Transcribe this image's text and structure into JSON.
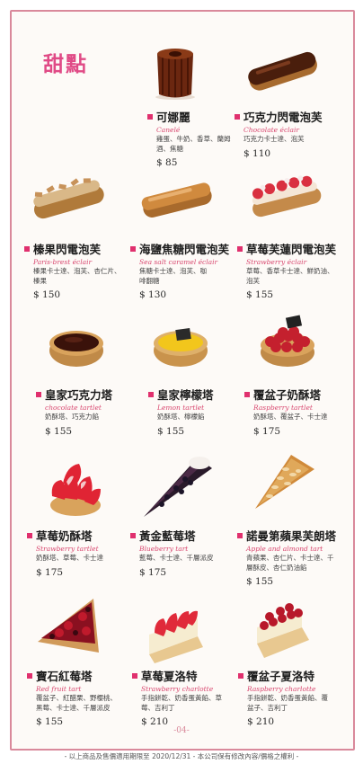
{
  "section_title": "甜點",
  "items": [
    {
      "name": "可娜麗",
      "en": "Canelé",
      "ing": "雞蛋、牛奶、香草、蘭姆酒、焦糖",
      "price": "$ 85"
    },
    {
      "name": "巧克力閃電泡芙",
      "en": "Chocolate éclair",
      "ing": "巧克力卡士達、泡芙",
      "price": "$ 110"
    },
    {
      "name": "榛果閃電泡芙",
      "en": "Paris-brest éclair",
      "ing": "榛果卡士達、泡芙、杏仁片、榛果",
      "price": "$ 150"
    },
    {
      "name": "海鹽焦糖閃電泡芙",
      "en": "Sea salt caramel éclair",
      "ing": "焦糖卡士達、泡芙、咖啡翻糖",
      "price": "$ 130"
    },
    {
      "name": "草莓芙蓮閃電泡芙",
      "en": "Strawberry éclair",
      "ing": "草莓、香草卡士達、鮮奶油、泡芙",
      "price": "$ 155"
    },
    {
      "name": "皇家巧克力塔",
      "en": "chocolate tartlet",
      "ing": "奶酥塔、巧克力餡",
      "price": "$ 155"
    },
    {
      "name": "皇家檸檬塔",
      "en": "Lemon tartlet",
      "ing": "奶酥塔、檸檬餡",
      "price": "$ 155"
    },
    {
      "name": "覆盆子奶酥塔",
      "en": "Raspberry tartlet",
      "ing": "奶酥塔、覆盆子、卡士達",
      "price": "$ 175"
    },
    {
      "name": "草莓奶酥塔",
      "en": "Strawberry tartlet",
      "ing": "奶酥塔、草莓、卡士達",
      "price": "$ 175"
    },
    {
      "name": "黃金藍莓塔",
      "en": "Blueberry tart",
      "ing": "藍莓、卡士達、千層派皮",
      "price": "$ 175"
    },
    {
      "name": "諾曼第蘋果芙朗塔",
      "en": "Apple and almond tart",
      "ing": "青蘋果、杏仁片、卡士達、千層酥皮、杏仁奶油餡",
      "price": "$ 155"
    },
    {
      "name": "寶石紅莓塔",
      "en": "Red fruit tart",
      "ing": "覆盆子、紅醋栗、野櫻桃、黑莓、卡士達、千層派皮",
      "price": "$ 155"
    },
    {
      "name": "草莓夏洛特",
      "en": "Strawberry charlotte",
      "ing": "手指餅乾、奶香蛋黃餡、草莓、吉利丁",
      "price": "$ 210"
    },
    {
      "name": "覆盆子夏洛特",
      "en": "Raspberry charlotte",
      "ing": "手指餅乾、奶香蛋黃餡、覆盆子、吉利丁",
      "price": "$ 210"
    }
  ],
  "page_number": "-04-",
  "footer": "- 以上商品及售價適用期限至 2020/12/31 - 本公司保有修改內容/價格之權利 -"
}
